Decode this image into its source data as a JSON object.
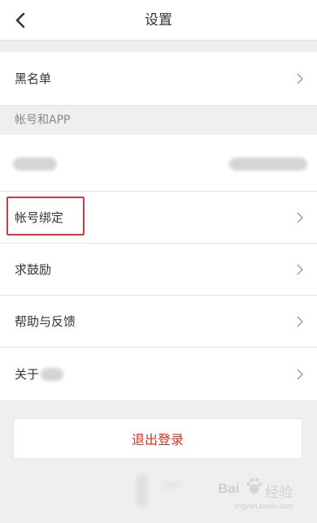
{
  "header": {
    "title": "设置"
  },
  "menu": {
    "blacklist_label": "黑名单",
    "section_label": "帐号和APP",
    "account_binding_label": "帐号绑定",
    "encourage_label": "求鼓励",
    "help_feedback_label": "帮助与反馈",
    "about_label": "关于"
  },
  "logout": {
    "label": "退出登录"
  },
  "watermark": {
    "text": "Bai",
    "text2": "经验",
    "sub": "jingyan.baidu.com"
  },
  "colors": {
    "accent": "#e02e24",
    "highlight": "#d9383b",
    "background": "#efefef"
  },
  "icons": [
    "back-arrow-icon",
    "chevron-right-icon",
    "baidu-paw-icon"
  ]
}
